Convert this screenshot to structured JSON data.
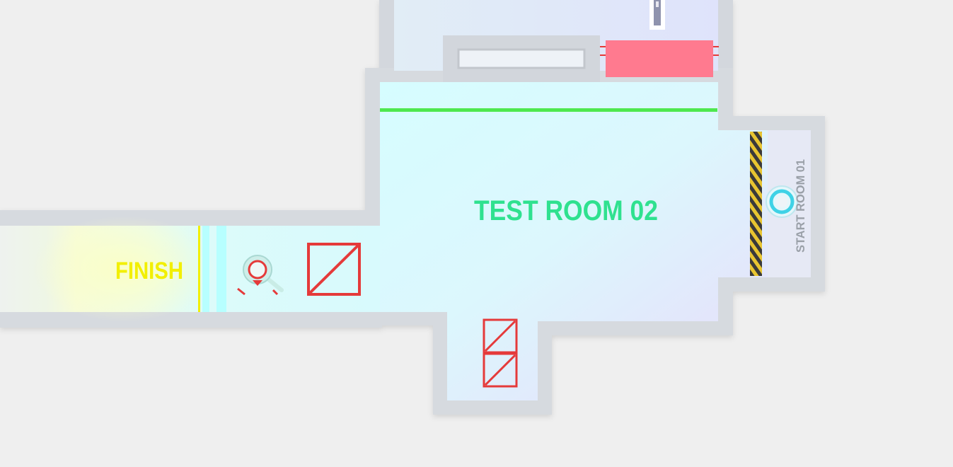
{
  "level": {
    "room_title": "TEST ROOM 02",
    "finish_label": "FINISH",
    "start_label": "START ROOM 01"
  },
  "colors": {
    "background": "#efefef",
    "wall": "#d6dadf",
    "floor_cyan": "#d9fbfd",
    "floor_lavender": "#e2e6fb",
    "finish_glow": "#f4fbcc",
    "title_text": "#2fe18f",
    "finish_text": "#f2ef00",
    "start_text": "#9aa0a8",
    "laser_line": "#4ee84e",
    "crate": "#e53a3a",
    "pink_block": "#ff7a8f",
    "hazard_stripe_a": "#e8c530",
    "hazard_stripe_b": "#3a3a3a",
    "exit_bar": "#b7ffff"
  },
  "objects": {
    "player_icon": "player-character",
    "goal_icon": "start-pad",
    "crates": [
      "crate",
      "crate",
      "crate"
    ],
    "barrier_icon": "laser-barrier"
  }
}
